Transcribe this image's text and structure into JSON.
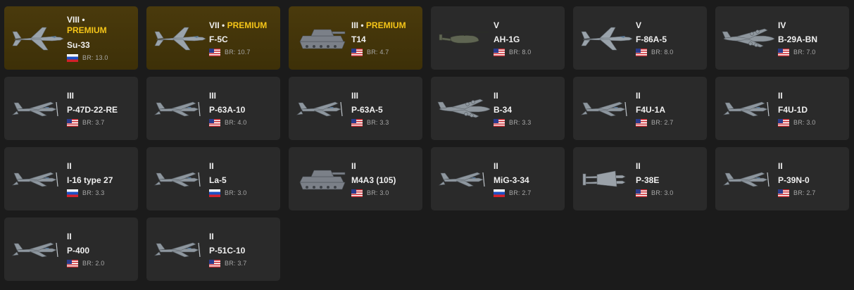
{
  "br_label": "BR:",
  "premium_label": "PREMIUM",
  "separator": "•",
  "colors": {
    "background": "#1b1b1b",
    "card": "#2a2a2a",
    "premium_card": "#4a3a0c",
    "premium_text": "#f5c518"
  },
  "vehicles": [
    {
      "rank": "VIII",
      "premium": true,
      "name": "Su-33",
      "flag": "russia-flag-icon",
      "br": "13.0",
      "icon": "jet-fighter-icon"
    },
    {
      "rank": "VII",
      "premium": true,
      "name": "F-5C",
      "flag": "usa-flag-icon",
      "br": "10.7",
      "icon": "jet-fighter-icon"
    },
    {
      "rank": "III",
      "premium": true,
      "name": "T14",
      "flag": "usa-flag-icon",
      "br": "4.7",
      "icon": "tank-icon"
    },
    {
      "rank": "V",
      "premium": false,
      "name": "AH-1G",
      "flag": "usa-flag-icon",
      "br": "8.0",
      "icon": "helicopter-icon"
    },
    {
      "rank": "V",
      "premium": false,
      "name": "F-86A-5",
      "flag": "usa-flag-icon",
      "br": "8.0",
      "icon": "jet-fighter-icon"
    },
    {
      "rank": "IV",
      "premium": false,
      "name": "B-29A-BN",
      "flag": "usa-flag-icon",
      "br": "7.0",
      "icon": "bomber-icon"
    },
    {
      "rank": "III",
      "premium": false,
      "name": "P-47D-22-RE",
      "flag": "usa-flag-icon",
      "br": "3.7",
      "icon": "prop-fighter-icon"
    },
    {
      "rank": "III",
      "premium": false,
      "name": "P-63A-10",
      "flag": "usa-flag-icon",
      "br": "4.0",
      "icon": "prop-fighter-icon"
    },
    {
      "rank": "III",
      "premium": false,
      "name": "P-63A-5",
      "flag": "usa-flag-icon",
      "br": "3.3",
      "icon": "prop-fighter-icon"
    },
    {
      "rank": "II",
      "premium": false,
      "name": "B-34",
      "flag": "usa-flag-icon",
      "br": "3.3",
      "icon": "bomber-icon"
    },
    {
      "rank": "II",
      "premium": false,
      "name": "F4U-1A",
      "flag": "usa-flag-icon",
      "br": "2.7",
      "icon": "prop-fighter-icon"
    },
    {
      "rank": "II",
      "premium": false,
      "name": "F4U-1D",
      "flag": "usa-flag-icon",
      "br": "3.0",
      "icon": "prop-fighter-icon"
    },
    {
      "rank": "II",
      "premium": false,
      "name": "I-16 type 27",
      "flag": "russia-flag-icon",
      "br": "3.3",
      "icon": "prop-fighter-icon"
    },
    {
      "rank": "II",
      "premium": false,
      "name": "La-5",
      "flag": "russia-flag-icon",
      "br": "3.0",
      "icon": "prop-fighter-icon"
    },
    {
      "rank": "II",
      "premium": false,
      "name": "M4A3 (105)",
      "flag": "usa-flag-icon",
      "br": "3.0",
      "icon": "tank-icon"
    },
    {
      "rank": "II",
      "premium": false,
      "name": "MiG-3-34",
      "flag": "russia-flag-icon",
      "br": "2.7",
      "icon": "prop-fighter-icon"
    },
    {
      "rank": "II",
      "premium": false,
      "name": "P-38E",
      "flag": "usa-flag-icon",
      "br": "3.0",
      "icon": "twin-engine-fighter-icon"
    },
    {
      "rank": "II",
      "premium": false,
      "name": "P-39N-0",
      "flag": "usa-flag-icon",
      "br": "2.7",
      "icon": "prop-fighter-icon"
    },
    {
      "rank": "II",
      "premium": false,
      "name": "P-400",
      "flag": "usa-flag-icon",
      "br": "2.0",
      "icon": "prop-fighter-icon"
    },
    {
      "rank": "II",
      "premium": false,
      "name": "P-51C-10",
      "flag": "usa-flag-icon",
      "br": "3.7",
      "icon": "prop-fighter-icon"
    }
  ]
}
